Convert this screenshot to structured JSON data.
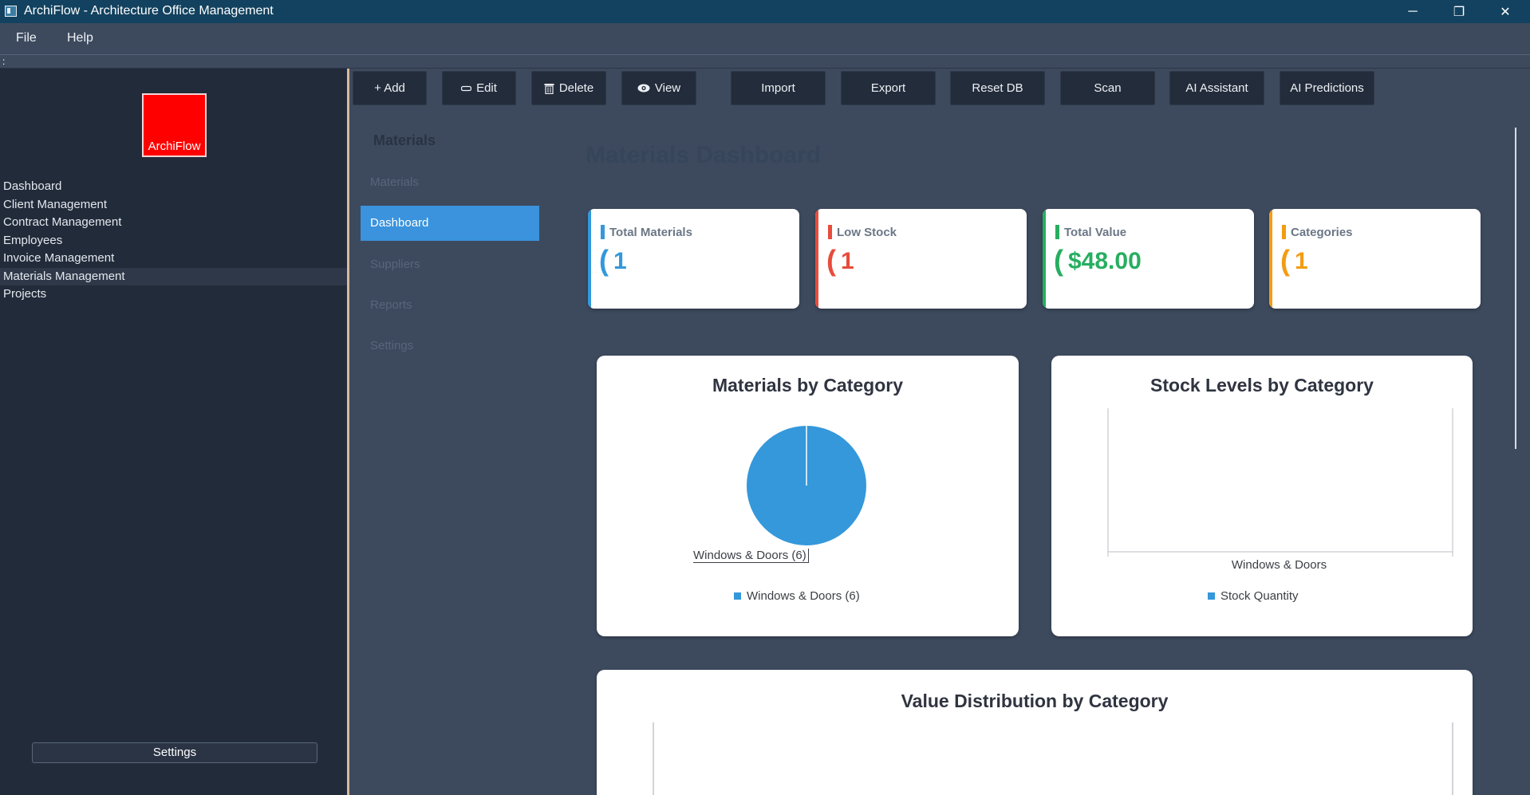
{
  "window": {
    "title": "ArchiFlow - Architecture Office Management",
    "minimize_glyph": "─",
    "restore_glyph": "❐",
    "close_glyph": "✕"
  },
  "menu": {
    "items": [
      "File",
      "Help"
    ]
  },
  "toolbar_handle": ":",
  "sidebar": {
    "logo_text": "ArchiFlow",
    "items": [
      "Dashboard",
      "Client Management",
      "Contract Management",
      "Employees",
      "Invoice Management",
      "Materials Management",
      "Projects"
    ],
    "active": "Materials Management",
    "settings_label": "Settings"
  },
  "toolbar": {
    "buttons": [
      {
        "label": "+ Add",
        "icon": ""
      },
      {
        "label": "Edit",
        "icon": "pencil-icon"
      },
      {
        "label": "Delete",
        "icon": "trash-icon"
      },
      {
        "label": "View",
        "icon": "eye-icon"
      },
      {
        "label": "Import",
        "icon": ""
      },
      {
        "label": "Export",
        "icon": ""
      },
      {
        "label": "Reset DB",
        "icon": ""
      },
      {
        "label": "Scan",
        "icon": ""
      },
      {
        "label": "AI Assistant",
        "icon": ""
      },
      {
        "label": "AI Predictions",
        "icon": ""
      }
    ]
  },
  "subnav": {
    "title": "Materials",
    "items": [
      "Materials",
      "Dashboard",
      "Suppliers",
      "Reports",
      "Settings"
    ],
    "active": "Dashboard"
  },
  "main": {
    "title": "Materials Dashboard",
    "cards": [
      {
        "label": "Total Materials",
        "value": "1",
        "color": "#3498db"
      },
      {
        "label": "Low Stock",
        "value": "1",
        "color": "#e74c3c"
      },
      {
        "label": "Total Value",
        "value": "$48.00",
        "color": "#27ae60"
      },
      {
        "label": "Categories",
        "value": "1",
        "color": "#f39c12"
      }
    ]
  },
  "charts": {
    "pie_title": "Materials by Category",
    "pie_slice_label": "Windows & Doors (6)",
    "pie_legend": "Windows & Doors (6)",
    "bar_title": "Stock Levels by Category",
    "bar_category": "Windows & Doors",
    "bar_legend": "Stock Quantity",
    "value_title": "Value Distribution by Category"
  },
  "chart_data": [
    {
      "type": "pie",
      "title": "Materials by Category",
      "categories": [
        "Windows & Doors"
      ],
      "values": [
        6
      ],
      "colors": [
        "#3498db"
      ]
    },
    {
      "type": "bar",
      "title": "Stock Levels by Category",
      "categories": [
        "Windows & Doors"
      ],
      "series": [
        {
          "name": "Stock Quantity",
          "values": [
            0
          ]
        }
      ],
      "grid": false,
      "legend": "bottom"
    },
    {
      "type": "bar",
      "title": "Value Distribution by Category",
      "categories": [],
      "series": []
    }
  ],
  "colors": {
    "accent": "#3a93dc",
    "series": "#3498db",
    "titlebar": "#12425f",
    "sidebar_bg": "#222b3a",
    "content_bg": "#3d4a5e"
  }
}
